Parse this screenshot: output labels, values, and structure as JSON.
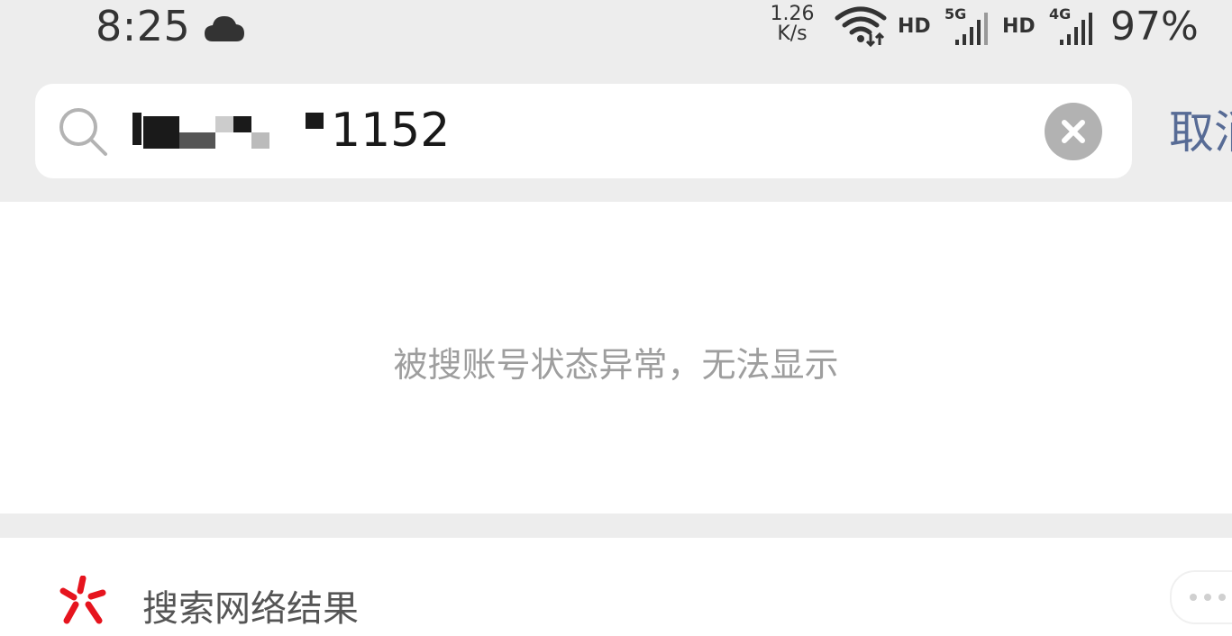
{
  "status_bar": {
    "time": "8:25",
    "weather_icon": "cloud-icon",
    "net_speed_value": "1.26",
    "net_speed_unit": "K/s",
    "hd_label_1": "HD",
    "network_1": "5G",
    "hd_label_2": "HD",
    "network_2": "4G",
    "battery": "97%"
  },
  "search": {
    "query_visible_suffix": "1152",
    "clear_icon": "clear-icon",
    "cancel_label": "取消"
  },
  "results": {
    "empty_message": "被搜账号状态异常，无法显示"
  },
  "web_search": {
    "label": "搜索网络结果",
    "icon": "sou-icon"
  },
  "colors": {
    "background": "#ededed",
    "link": "#576b95",
    "accent_red": "#e6141e"
  }
}
